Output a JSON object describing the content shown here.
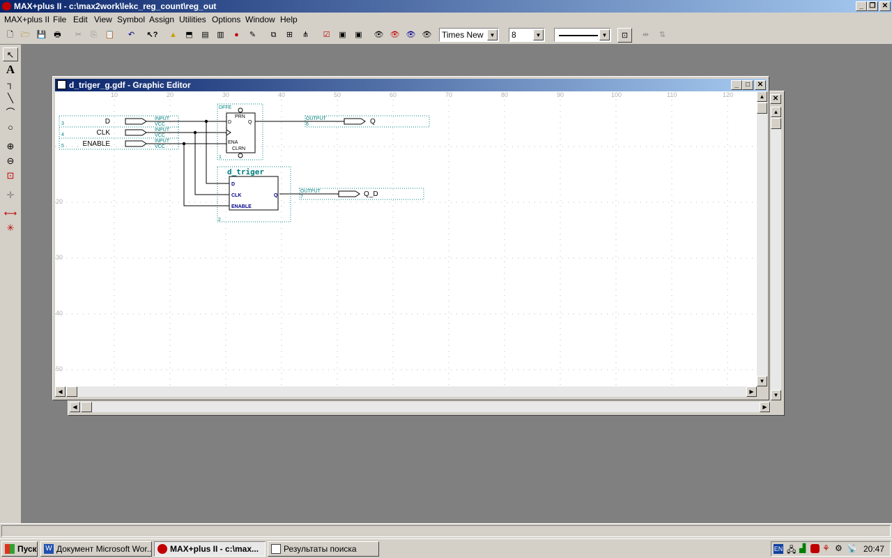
{
  "app": {
    "title": "MAX+plus II - c:\\max2work\\lekc_reg_count\\reg_out"
  },
  "menu": [
    "MAX+plus II",
    "File",
    "Edit",
    "View",
    "Symbol",
    "Assign",
    "Utilities",
    "Options",
    "Window",
    "Help"
  ],
  "toolbar": {
    "font_name": "Times New",
    "font_size": "8"
  },
  "editor": {
    "title": "d_triger_g.gdf - Graphic Editor",
    "ruler_top": [
      "10",
      "20",
      "30",
      "40",
      "50",
      "60",
      "70",
      "80",
      "90",
      "100",
      "110",
      "120"
    ],
    "ruler_left": [
      "20",
      "30",
      "40",
      "50"
    ],
    "inputs": [
      {
        "name": "D",
        "type": "INPUT",
        "default": "VCC",
        "num": "3"
      },
      {
        "name": "CLK",
        "type": "INPUT",
        "default": "VCC",
        "num": "4"
      },
      {
        "name": "ENABLE",
        "type": "INPUT",
        "default": "VCC",
        "num": "5"
      }
    ],
    "dffe": {
      "name": "DFFE",
      "ports": [
        "PRN",
        "D",
        "Q",
        "ENA",
        "CLRN"
      ],
      "num": "1"
    },
    "dtriger": {
      "name": "d_triger",
      "ports": [
        "D",
        "CLK",
        "ENABLE",
        "Q"
      ],
      "num": "2"
    },
    "outputs": [
      {
        "name": "Q",
        "type": "OUTPUT",
        "num": "6"
      },
      {
        "name": "Q_D",
        "type": "OUTPUT",
        "num": "7"
      }
    ]
  },
  "taskbar": {
    "start": "Пуск",
    "tasks": [
      "Документ Microsoft Wor...",
      "MAX+plus II - c:\\max...",
      "Результаты поиска"
    ],
    "lang": "EN",
    "time": "20:47"
  }
}
